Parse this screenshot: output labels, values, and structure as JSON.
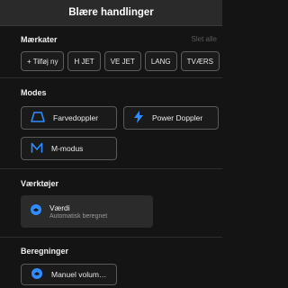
{
  "header": {
    "title": "Blære handlinger"
  },
  "tags": {
    "label": "Mærkater",
    "clear_all": "Slet alle",
    "chips": [
      "+ Tilføj ny",
      "H JET",
      "VE JET",
      "LANG",
      "TVÆRS"
    ]
  },
  "modes": {
    "label": "Modes",
    "items": [
      {
        "label": "Farvedoppler",
        "icon": "color-doppler-icon"
      },
      {
        "label": "Power Doppler",
        "icon": "lightning-icon"
      },
      {
        "label": "M-modus",
        "icon": "m-mode-icon"
      }
    ]
  },
  "tools": {
    "label": "Værktøjer",
    "items": [
      {
        "title": "Værdi",
        "subtitle": "Automatisk beregnet",
        "icon": "bladder-icon"
      }
    ]
  },
  "calculations": {
    "label": "Beregninger",
    "items": [
      {
        "label": "Manuel volumen",
        "icon": "bladder-icon"
      }
    ]
  },
  "colors": {
    "accent": "#2f8cff",
    "background": "#141414",
    "header": "#2a2a2a"
  }
}
